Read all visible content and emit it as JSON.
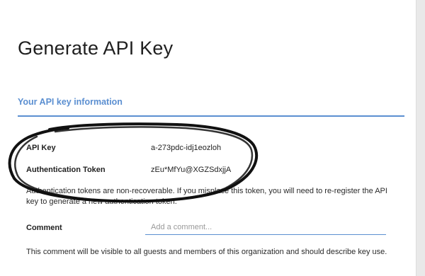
{
  "page": {
    "title": "Generate API Key"
  },
  "section": {
    "heading": "Your API key information"
  },
  "fields": [
    {
      "label": "API Key",
      "value": "a-273pdc-idj1eozloh"
    },
    {
      "label": "Authentication Token",
      "value": "zEu*MfYu@XGZSdxjjA"
    }
  ],
  "notice": "Authentication tokens are non-recoverable. If you misplace this token, you will need to re-register the API key to generate a new authentication token.",
  "comment": {
    "label": "Comment",
    "placeholder": "Add a comment...",
    "value": ""
  },
  "footer_note": "This comment will be visible to all guests and members of this organization and should describe key use.",
  "colors": {
    "accent": "#5b8fd1",
    "annotation_ink": "#111111"
  }
}
